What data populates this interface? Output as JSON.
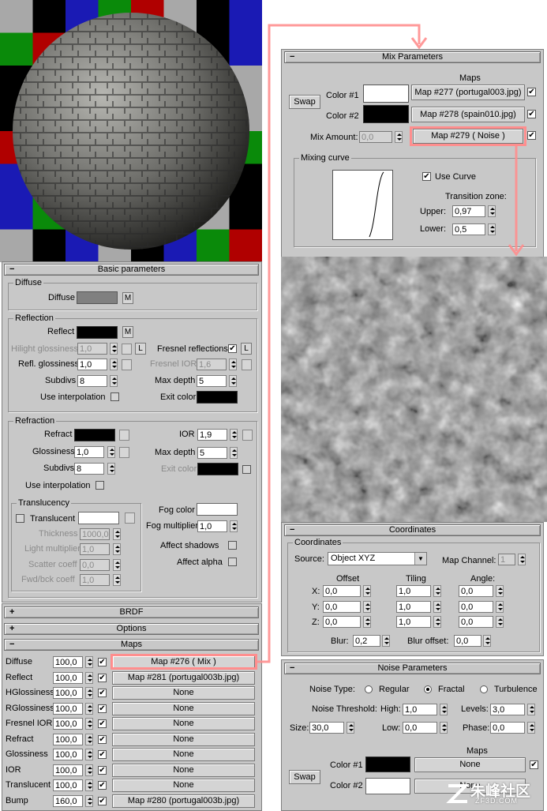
{
  "mix": {
    "header": "Mix Parameters",
    "maps_label": "Maps",
    "swap": "Swap",
    "color1_label": "Color #1",
    "color2_label": "Color #2",
    "color1_map": "Map #277 (portugal003.jpg)",
    "color2_map": "Map #278 (spain010.jpg)",
    "amount_label": "Mix Amount:",
    "amount_value": "0,0",
    "amount_map": "Map #279  ( Noise )",
    "mixing_curve": "Mixing curve",
    "use_curve": "Use Curve",
    "transition_zone": "Transition zone:",
    "upper_label": "Upper:",
    "upper_value": "0,97",
    "lower_label": "Lower:",
    "lower_value": "0,5"
  },
  "basic": {
    "header": "Basic parameters",
    "diffuse_group": "Diffuse",
    "diffuse_label": "Diffuse",
    "m": "M",
    "l": "L",
    "reflection_group": "Reflection",
    "reflect_label": "Reflect",
    "hilight_label": "Hilight glossiness",
    "hilight_value": "1,0",
    "refl_gloss_label": "Refl. glossiness",
    "refl_gloss_value": "1,0",
    "subdivs_label": "Subdivs",
    "subdivs_value": "8",
    "use_interp_label": "Use interpolation",
    "fresnel_label": "Fresnel reflections",
    "fresnel_ior_label": "Fresnel IOR",
    "fresnel_ior_value": "1,6",
    "max_depth_label": "Max depth",
    "max_depth_value": "5",
    "exit_color_label": "Exit color",
    "refraction_group": "Refraction",
    "refract_label": "Refract",
    "glossiness_label": "Glossiness",
    "glossiness_value": "1,0",
    "rsubdivs_label": "Subdivs",
    "rsubdivs_value": "8",
    "ruse_interp_label": "Use interpolation",
    "ior_label": "IOR",
    "ior_value": "1,9",
    "rmax_depth_label": "Max depth",
    "rmax_depth_value": "5",
    "rexit_color_label": "Exit color",
    "translucency_group": "Translucency",
    "translucent_label": "Translucent",
    "thickness_label": "Thickness",
    "thickness_value": "1000,0",
    "light_mult_label": "Light multiplier",
    "light_mult_value": "1,0",
    "scatter_label": "Scatter coeff",
    "scatter_value": "0,0",
    "fwd_label": "Fwd/bck coeff",
    "fwd_value": "1,0",
    "fog_color_label": "Fog color",
    "fog_mult_label": "Fog multiplier",
    "fog_mult_value": "1,0",
    "affect_shadows_label": "Affect shadows",
    "affect_alpha_label": "Affect alpha"
  },
  "brdf": {
    "header": "BRDF"
  },
  "options": {
    "header": "Options"
  },
  "maps": {
    "header": "Maps",
    "rows": [
      {
        "label": "Diffuse",
        "amount": "100,0",
        "map": "Map #276  ( Mix )"
      },
      {
        "label": "Reflect",
        "amount": "100,0",
        "map": "Map #281 (portugal003b.jpg)"
      },
      {
        "label": "HGlossiness",
        "amount": "100,0",
        "map": "None"
      },
      {
        "label": "RGlossiness",
        "amount": "100,0",
        "map": "None"
      },
      {
        "label": "Fresnel IOR",
        "amount": "100,0",
        "map": "None"
      },
      {
        "label": "Refract",
        "amount": "100,0",
        "map": "None"
      },
      {
        "label": "Glossiness",
        "amount": "100,0",
        "map": "None"
      },
      {
        "label": "IOR",
        "amount": "100,0",
        "map": "None"
      },
      {
        "label": "Translucent",
        "amount": "100,0",
        "map": "None"
      },
      {
        "label": "Bump",
        "amount": "160,0",
        "map": "Map #280 (portugal003b.jpg)"
      }
    ]
  },
  "coords": {
    "header": "Coordinates",
    "group": "Coordinates",
    "source_label": "Source:",
    "source_value": "Object XYZ",
    "map_channel_label": "Map Channel:",
    "map_channel_value": "1",
    "offset": "Offset",
    "tiling": "Tiling",
    "angle": "Angle:",
    "rows": [
      {
        "axis": "X:",
        "offset": "0,0",
        "tiling": "1,0",
        "angle": "0,0"
      },
      {
        "axis": "Y:",
        "offset": "0,0",
        "tiling": "1,0",
        "angle": "0,0"
      },
      {
        "axis": "Z:",
        "offset": "0,0",
        "tiling": "1,0",
        "angle": "0,0"
      }
    ],
    "blur_label": "Blur:",
    "blur_value": "0,2",
    "blur_offset_label": "Blur offset:",
    "blur_offset_value": "0,0"
  },
  "noise": {
    "header": "Noise Parameters",
    "type_label": "Noise Type:",
    "regular": "Regular",
    "fractal": "Fractal",
    "turbulence": "Turbulence",
    "threshold_label": "Noise Threshold:",
    "high_label": "High:",
    "high_value": "1,0",
    "levels_label": "Levels:",
    "levels_value": "3,0",
    "size_label": "Size:",
    "size_value": "30,0",
    "low_label": "Low:",
    "low_value": "0,0",
    "phase_label": "Phase:",
    "phase_value": "0,0",
    "maps_label": "Maps",
    "swap": "Swap",
    "color1_label": "Color #1",
    "color2_label": "Color #2",
    "none": "None"
  },
  "watermark": "朱峰社区",
  "watermark_sub": "ZF3D.COM",
  "colors": {
    "panel_bg": "#c8c8c8",
    "highlight": "#ff8e8e",
    "diffuse_swatch": "#808080"
  }
}
